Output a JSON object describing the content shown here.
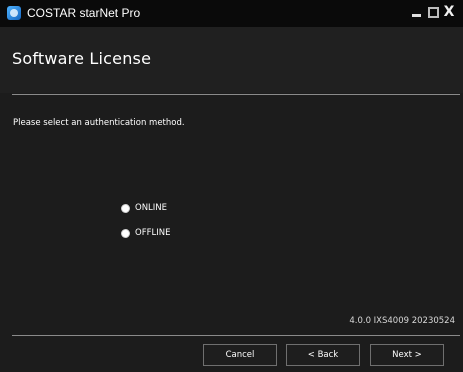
{
  "window": {
    "title": "COSTAR starNet Pro",
    "icon": "app-logo-icon",
    "controls": [
      "minimize-icon",
      "maximize-icon",
      "close-icon"
    ],
    "close_glyph": "X"
  },
  "header": {
    "title": "Software License"
  },
  "body": {
    "prompt": "Please select an authentication method.",
    "options": [
      {
        "label": "ONLINE"
      },
      {
        "label": "OFFLINE"
      }
    ],
    "version": "4.0.0 IXS4009 20230524"
  },
  "footer": {
    "cancel_label": "Cancel",
    "back_label": "< Back",
    "next_label": "Next >"
  },
  "colors": {
    "background": "#1c1c1c",
    "titlebar": "#0a0a0a",
    "text": "#ffffff",
    "divider": "#8a8a8a"
  }
}
